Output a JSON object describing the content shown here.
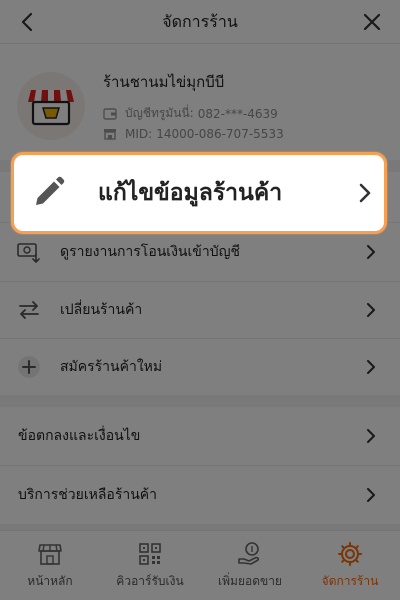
{
  "header": {
    "title": "จัดการร้าน"
  },
  "shop": {
    "name": "ร้านชานมไข่มุกบีบี",
    "account_label": "บัญชีทรูมันนี่:",
    "account_value": "082-***-4639",
    "mid_label": "MID:",
    "mid_value": "14000-086-707-5533"
  },
  "highlight": {
    "label": "แก้ไขข้อมูลร้านค้า"
  },
  "menu": {
    "items": [
      {
        "label": "ดูรายงานการโอนเงินเข้าบัญชี",
        "icon": "money-transfer-icon"
      },
      {
        "label": "เปลี่ยนร้านค้า",
        "icon": "swap-arrows-icon"
      },
      {
        "label": "สมัครร้านค้าใหม่",
        "icon": "plus-icon"
      }
    ],
    "secondary": [
      {
        "label": "ข้อตกลงและเงื่อนไข"
      },
      {
        "label": "บริการช่วยเหลือร้านค้า"
      }
    ]
  },
  "bottom_nav": {
    "items": [
      {
        "label": "หน้าหลัก",
        "icon": "store-icon"
      },
      {
        "label": "คิวอาร์รับเงิน",
        "icon": "qr-code-icon"
      },
      {
        "label": "เพิ่มยอดขาย",
        "icon": "hand-coin-icon"
      },
      {
        "label": "จัดการร้าน",
        "icon": "gear-icon",
        "active": true
      }
    ]
  },
  "colors": {
    "accent": "#f06a0f",
    "highlight_border": "#f5a052",
    "overlay": "rgba(0,0,0,0.5)"
  }
}
